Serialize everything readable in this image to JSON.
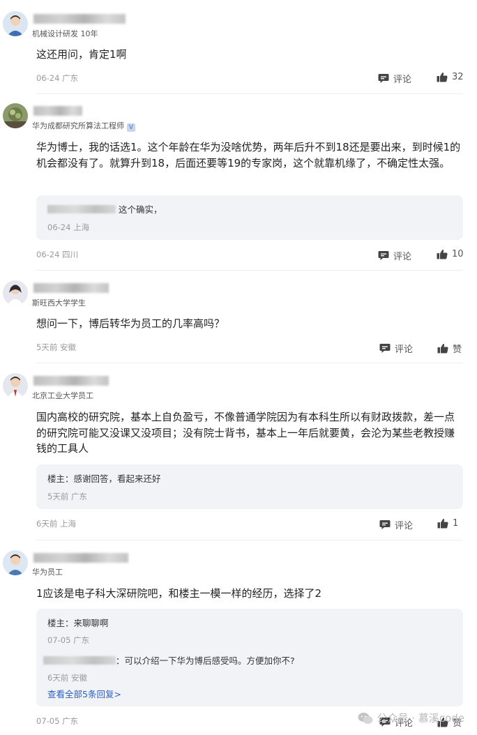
{
  "comments": [
    {
      "subtitle": "机械设计研发 10年",
      "content": "这还用问，肯定1啊",
      "meta": "06-24 广东",
      "comment_label": "评论",
      "like_label": "32"
    },
    {
      "subtitle": "华为成都研究所算法工程师",
      "verified_mark": "V",
      "content": "华为博士，我的话选1。这个年龄在华为没啥优势，两年后升不到18还是要出来，到时候1的机会都没有了。就算升到18，后面还要等19的专家岗，这个就靠机缘了，不确定性太强。",
      "reply": {
        "text": "这个确实，",
        "meta": "06-24 上海"
      },
      "meta": "06-24 四川",
      "comment_label": "评论",
      "like_label": "10"
    },
    {
      "subtitle": "斯旺西大学学生",
      "content": "想问一下，博后转华为员工的几率高吗？",
      "meta": "5天前 安徽",
      "comment_label": "评论",
      "like_label": "赞"
    },
    {
      "subtitle": "北京工业大学员工",
      "content": "国内高校的研究院，基本上自负盈亏，不像普通学院因为有本科生所以有财政拨款，差一点的研究院可能又没课又没项目；没有院士背书，基本上一年后就要黄，会沦为某些老教授赚钱的工具人",
      "reply": {
        "author": "楼主",
        "text": "：感谢回答，看起来还好",
        "meta": "5天前 广东"
      },
      "meta": "6天前 上海",
      "comment_label": "评论",
      "like_label": "1"
    },
    {
      "subtitle": "华为员工",
      "content": "1应该是电子科大深研院吧，和楼主一模一样的经历，选择了2",
      "replies": [
        {
          "author": "楼主",
          "text": "：来聊聊啊",
          "meta": "07-05 广东"
        },
        {
          "text": "：可以介绍一下华为博后感受吗。方便加你不?",
          "meta": "6天前 安徽"
        }
      ],
      "more_link": "查看全部5条回复>",
      "meta": "07-05 广东",
      "comment_label": "评论",
      "like_label": "赞"
    }
  ],
  "watermark": {
    "label": "公众号 · 慕溪code"
  }
}
